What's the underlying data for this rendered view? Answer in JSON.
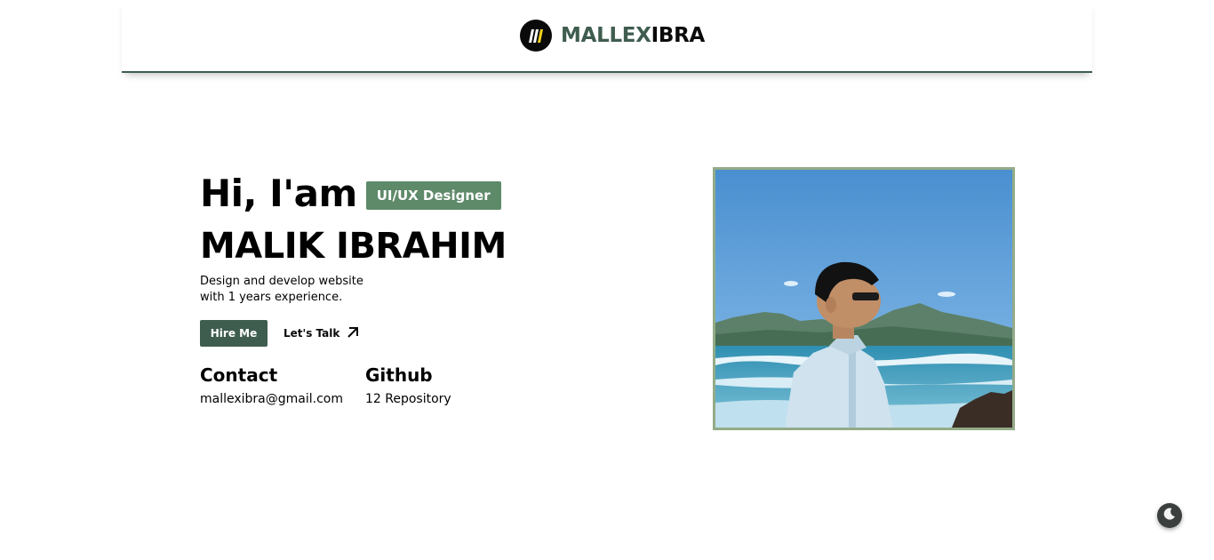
{
  "header": {
    "brand_accent": "MALLEX",
    "brand_rest": "IBRA",
    "logo_icon": "mi-monogram-logo"
  },
  "hero": {
    "greeting": "Hi, I'am",
    "role": "UI/UX Designer",
    "name": "MALIK IBRAHIM",
    "tagline_line1": "Design and develop website",
    "tagline_line2": "with 1 years experience.",
    "hire_label": "Hire Me",
    "talk_label": "Let's Talk",
    "talk_icon": "arrow-up-right-icon"
  },
  "info": {
    "contact_title": "Contact",
    "contact_value": "mallexibra@gmail.com",
    "github_title": "Github",
    "github_value": "12 Repository"
  },
  "theme_toggle": {
    "icon": "moon-icon"
  },
  "colors": {
    "accent": "#3f5d4f",
    "badge": "#5f8a6a",
    "photo_border": "#93ab88"
  }
}
